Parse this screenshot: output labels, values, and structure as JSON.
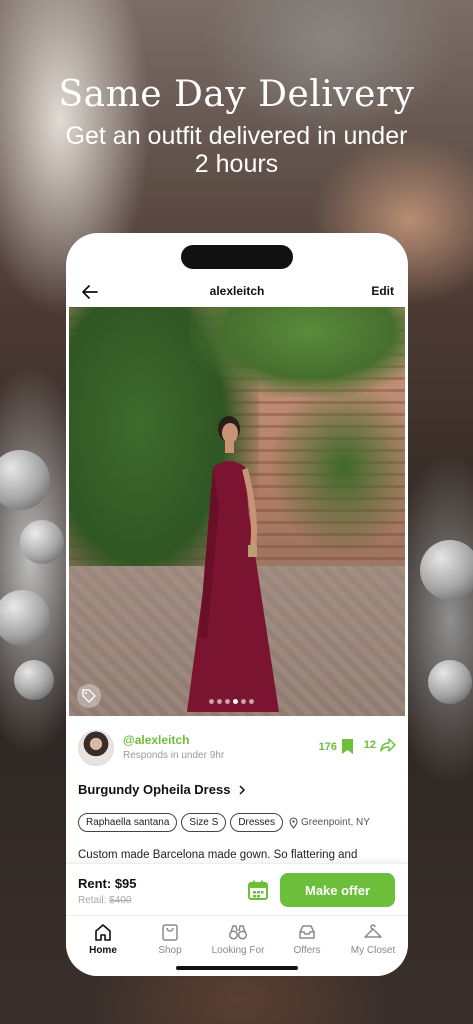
{
  "hero": {
    "title": "Same Day Delivery",
    "subtitle": "Get an outfit delivered in under 2 hours"
  },
  "topbar": {
    "title": "alexleitch",
    "edit_label": "Edit"
  },
  "photo": {
    "carousel_total": 6,
    "carousel_active_index": 3
  },
  "seller": {
    "handle": "@alexleitch",
    "responds": "Responds in under 9hr",
    "saves_count": "176",
    "shares_count": "12"
  },
  "item": {
    "title": "Burgundy Opheila Dress",
    "chips": [
      "Raphaella santana",
      "Size S",
      "Dresses"
    ],
    "location": "Greenpoint, NY",
    "description": "Custom made Barcelona made gown. So flattering and"
  },
  "pricing": {
    "rent_label": "Rent: $95",
    "retail_label": "Retail:",
    "retail_value": "$400",
    "offer_button": "Make offer"
  },
  "tabs": [
    {
      "label": "Home",
      "icon": "home-icon"
    },
    {
      "label": "Shop",
      "icon": "shopping-bag-icon"
    },
    {
      "label": "Looking For",
      "icon": "binoculars-icon"
    },
    {
      "label": "Offers",
      "icon": "inbox-icon"
    },
    {
      "label": "My Closet",
      "icon": "hanger-icon"
    }
  ],
  "colors": {
    "accent": "#6bbf3b",
    "dress": "#7a1430"
  }
}
